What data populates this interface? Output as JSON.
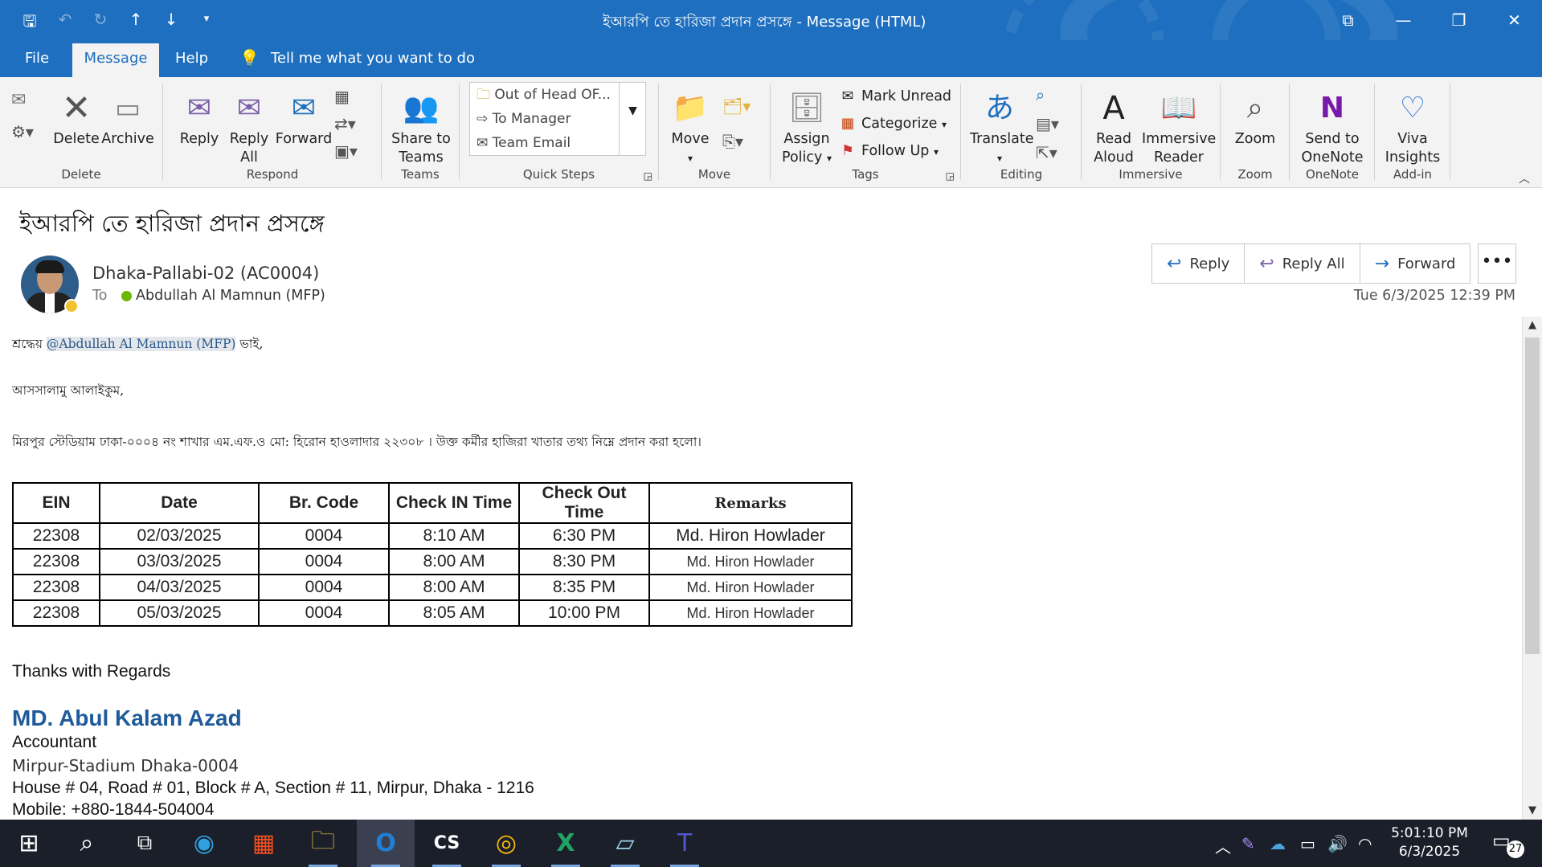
{
  "window": {
    "title": "ইআরপি তে হারিজা প্রদান প্রসঙ্গে  -  Message (HTML)"
  },
  "menu": {
    "file": "File",
    "message": "Message",
    "help": "Help",
    "tell_me": "Tell me what you want to do"
  },
  "ribbon": {
    "delete": {
      "delete": "Delete",
      "archive": "Archive",
      "group": "Delete"
    },
    "respond": {
      "reply": "Reply",
      "reply_all_1": "Reply",
      "reply_all_2": "All",
      "forward": "Forward",
      "group": "Respond"
    },
    "teams": {
      "share_1": "Share to",
      "share_2": "Teams",
      "group": "Teams"
    },
    "quick_steps": {
      "items": [
        "Out of Head OF...",
        "To Manager",
        "Team Email"
      ],
      "group": "Quick Steps"
    },
    "move": {
      "move": "Move",
      "group": "Move"
    },
    "tags": {
      "assign_1": "Assign",
      "assign_2": "Policy",
      "mark_unread": "Mark Unread",
      "categorize": "Categorize",
      "follow_up": "Follow Up",
      "group": "Tags"
    },
    "editing": {
      "translate": "Translate",
      "group": "Editing"
    },
    "immersive": {
      "read_1": "Read",
      "read_2": "Aloud",
      "reader_1": "Immersive",
      "reader_2": "Reader",
      "group": "Immersive"
    },
    "zoom": {
      "zoom": "Zoom",
      "group": "Zoom"
    },
    "onenote": {
      "send_1": "Send to",
      "send_2": "OneNote",
      "group": "OneNote"
    },
    "addin": {
      "viva_1": "Viva",
      "viva_2": "Insights",
      "group": "Add-in"
    }
  },
  "message": {
    "subject": "ইআরপি তে হারিজা প্রদান প্রসঙ্গে",
    "sender": "Dhaka-Pallabi-02 (AC0004)",
    "to_label": "To",
    "recipient": "Abdullah Al Mamnun (MFP)",
    "date": "Tue 6/3/2025 12:39 PM",
    "actions": {
      "reply": "Reply",
      "reply_all": "Reply All",
      "forward": "Forward"
    }
  },
  "body": {
    "greeting_prefix": "শ্রদ্ধেয় ",
    "mention": "@Abdullah Al Mamnun (MFP)",
    "greeting_suffix": " ভাই,",
    "salam": "আসসালামু আলাইকুম,",
    "intro": "মিরপুর স্টেডিয়াম ঢাকা-০০০৪ নং শাখার এম.এফ.ও মো: হিরোন হাওলাদার ২২৩০৮ । উক্ত কর্মীর হাজিরা খাতার তথ্য নিম্নে প্রদান করা হলো।",
    "table": {
      "headers": [
        "EIN",
        "Date",
        "Br. Code",
        "Check IN Time",
        "Check Out Time",
        "Remarks"
      ],
      "rows": [
        [
          "22308",
          "02/03/2025",
          "0004",
          "8:10 AM",
          "6:30 PM",
          "Md. Hiron Howlader"
        ],
        [
          "22308",
          "03/03/2025",
          "0004",
          "8:00 AM",
          "8:30 PM",
          "Md. Hiron Howlader"
        ],
        [
          "22308",
          "04/03/2025",
          "0004",
          "8:00 AM",
          "8:35 PM",
          "Md. Hiron Howlader"
        ],
        [
          "22308",
          "05/03/2025",
          "0004",
          "8:05 AM",
          "10:00 PM",
          "Md. Hiron Howlader"
        ]
      ]
    },
    "closing": "Thanks with Regards",
    "sig_name": "MD. Abul Kalam Azad",
    "sig_title": "Accountant",
    "sig_branch": "Mirpur-Stadium Dhaka-0004",
    "sig_address": "House # 04, Road # 01, Block # A, Section # 11, Mirpur, Dhaka - 1216",
    "sig_mobile": "Mobile: +880-1844-504004"
  },
  "taskbar": {
    "time": "5:01:10 PM",
    "date": "6/3/2025",
    "notifications": "27"
  },
  "colors": {
    "accent": "#1e6fbf",
    "signature_name": "#1f5a99",
    "taskbar": "#1b1f2a"
  }
}
